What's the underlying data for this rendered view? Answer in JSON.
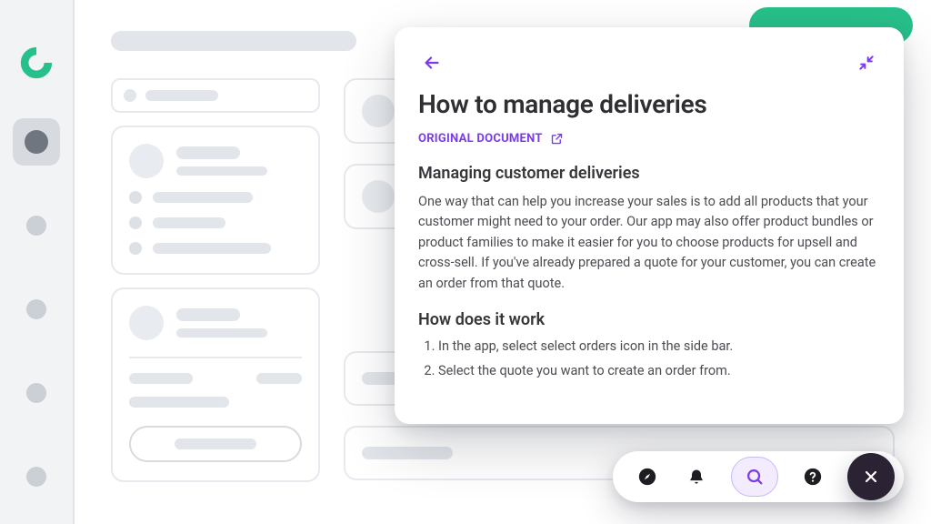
{
  "colors": {
    "accent": "#7B3AED",
    "brand": "#27C08A",
    "toolbar_close_bg": "#2B2334"
  },
  "panel": {
    "title": "How to manage deliveries",
    "original_link_label": "ORIGINAL DOCUMENT",
    "section1_heading": "Managing customer deliveries",
    "section1_body": "One way that can help you increase your sales is to add all products that your customer might need to your order. Our app may also offer product bundles or product families to make it easier for you to choose products for upsell and cross-sell. If you've already prepared a quote for your customer, you can create an order from that quote.",
    "section2_heading": "How does it work",
    "steps": [
      "In the app, select select orders icon in the side bar.",
      "Select the quote you want to create an order from."
    ]
  },
  "toolbar": {
    "icons": {
      "explore": "compass-icon",
      "notifications": "bell-icon",
      "search": "search-icon",
      "help": "help-icon",
      "close": "close-icon"
    }
  },
  "rail": {
    "items_count": 5,
    "active_index": 0
  }
}
